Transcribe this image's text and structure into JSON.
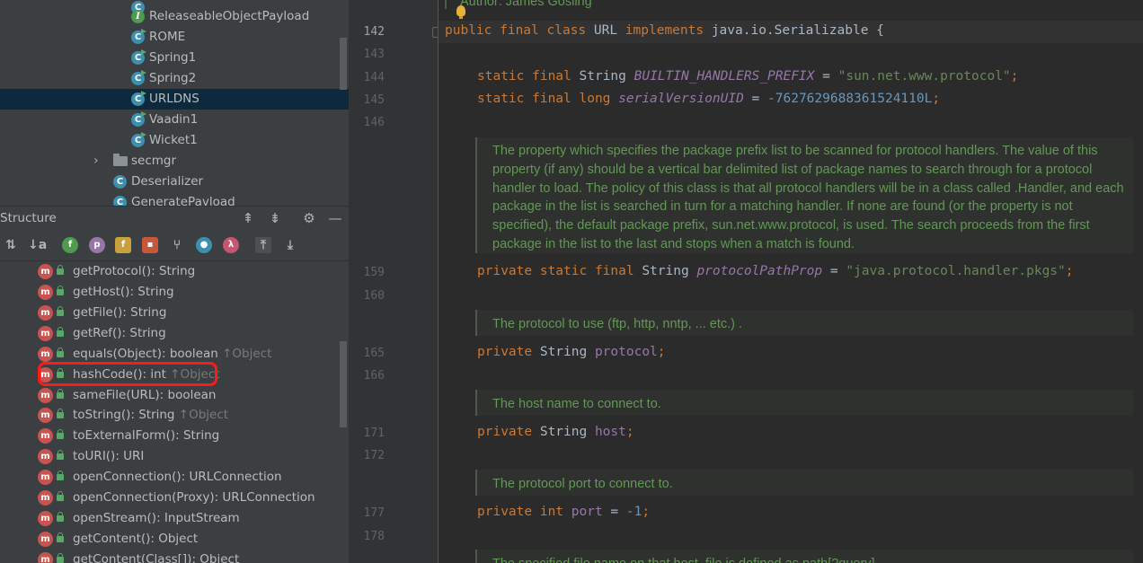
{
  "project_tree": {
    "items": [
      {
        "label": "ReleaseableObjectPayload",
        "icon": "interface-icon",
        "letter": "I"
      },
      {
        "label": "ROME",
        "icon": "class-icon",
        "letter": "C"
      },
      {
        "label": "Spring1",
        "icon": "class-icon",
        "letter": "C"
      },
      {
        "label": "Spring2",
        "icon": "class-icon",
        "letter": "C"
      },
      {
        "label": "URLDNS",
        "icon": "class-icon",
        "letter": "C",
        "selected": true
      },
      {
        "label": "Vaadin1",
        "icon": "class-icon",
        "letter": "C"
      },
      {
        "label": "Wicket1",
        "icon": "class-icon",
        "letter": "C"
      },
      {
        "label": "secmgr",
        "icon": "folder-icon"
      },
      {
        "label": "Deserializer",
        "icon": "class-icon",
        "letter": "C"
      },
      {
        "label": "GeneratePayload",
        "icon": "class-icon",
        "letter": "C"
      }
    ]
  },
  "structure": {
    "title": "Structure",
    "members": [
      {
        "name": "getProtocol(): String",
        "inherited": ""
      },
      {
        "name": "getHost(): String",
        "inherited": ""
      },
      {
        "name": "getFile(): String",
        "inherited": ""
      },
      {
        "name": "getRef(): String",
        "inherited": ""
      },
      {
        "name": "equals(Object): boolean ",
        "inherited": "↑Object"
      },
      {
        "name": "hashCode(): int ",
        "inherited": "↑Object"
      },
      {
        "name": "sameFile(URL): boolean",
        "inherited": ""
      },
      {
        "name": "toString(): String ",
        "inherited": "↑Object"
      },
      {
        "name": "toExternalForm(): String",
        "inherited": ""
      },
      {
        "name": "toURI(): URI",
        "inherited": ""
      },
      {
        "name": "openConnection(): URLConnection",
        "inherited": ""
      },
      {
        "name": "openConnection(Proxy): URLConnection",
        "inherited": ""
      },
      {
        "name": "openStream(): InputStream",
        "inherited": ""
      },
      {
        "name": "getContent(): Object",
        "inherited": ""
      },
      {
        "name": "getContent(Class[]): Object",
        "inherited": ""
      }
    ],
    "highlighted": "hashCode(): int"
  },
  "editor": {
    "author_line": "Author: James Gosling",
    "line_numbers": [
      "142",
      "143",
      "144",
      "145",
      "146",
      "159",
      "160",
      "165",
      "166",
      "171",
      "172",
      "177",
      "178"
    ],
    "docs": {
      "prefix_doc": "The property which specifies the package prefix list to be scanned for protocol handlers. The value of this property (if any) should be a vertical bar delimited list of package names to search through for a protocol handler to load. The policy of this class is that all protocol handlers will be in a class called .Handler, and each package in the list is searched in turn for a matching handler. If none are found (or the property is not specified), the default package prefix, sun.net.www.protocol, is used. The search proceeds from the first package in the list to the last and stops when a match is found.",
      "protocol_doc": "The protocol to use (ftp, http, nntp, ... etc.) .",
      "host_doc": "The host name to connect to.",
      "port_doc": "The protocol port to connect to.",
      "file_doc_partial": "The specified file name on that host. file is defined as path[?query]"
    },
    "code": {
      "class_decl": {
        "kw": "public final class ",
        "name": "URL ",
        "kw2": "implements ",
        "rest": "java.io.Serializable {"
      },
      "builtin": {
        "kw": "static final ",
        "type": "String ",
        "field": "BUILTIN_HANDLERS_PREFIX",
        "eq": " = ",
        "val": "\"sun.net.www.protocol\"",
        "end": ";"
      },
      "serial": {
        "kw": "static final long ",
        "field": "serialVersionUID",
        "eq": " = ",
        "val": "-7627629688361524110L",
        "end": ";"
      },
      "pathprop": {
        "kw": "private static final ",
        "type": "String ",
        "field": "protocolPathProp",
        "eq": " = ",
        "val": "\"java.protocol.handler.pkgs\"",
        "end": ";"
      },
      "protocol": {
        "kw": "private ",
        "type": "String ",
        "field": "protocol",
        "end": ";"
      },
      "host": {
        "kw": "private ",
        "type": "String ",
        "field": "host",
        "end": ";"
      },
      "port": {
        "kw": "private int ",
        "field": "port",
        "eq": " = ",
        "val": "-1",
        "end": ";"
      }
    }
  }
}
